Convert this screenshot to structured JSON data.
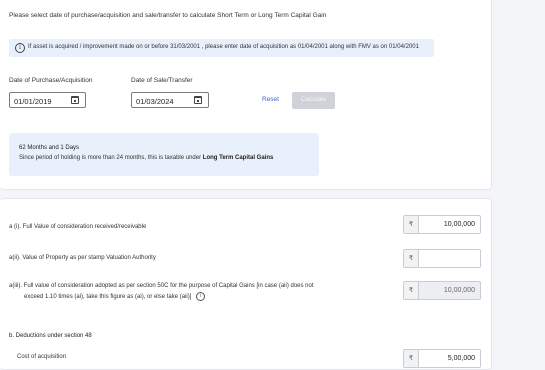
{
  "intro_text": "Please select date of purchase/acquisition and sale/transfer to calculate Short Term or Long Term Capital Gain",
  "info_banner": {
    "icon": "info-icon",
    "text": "If asset is acquired / improvement made on or before 31/03/2001 , please enter date of acquisition as 01/04/2001 along with FMV as on 01/04/2001"
  },
  "purchase": {
    "label": "Date of Purchase/Acquisition",
    "value": "01/01/2019"
  },
  "sale": {
    "label": "Date of Sale/Transfer",
    "value": "01/03/2024"
  },
  "actions": {
    "reset_label": "Reset",
    "calculate_label": "Calculate"
  },
  "result": {
    "duration": "62 Months and 1 Days",
    "text_prefix": "Since period of holding is more than 24 months, this is taxable under",
    "gain_type": "Long Term Capital Gains"
  },
  "rows": [
    {
      "label": "a (i). Full Value of consideration received/receivable",
      "currency": "₹",
      "value": "10,00,000",
      "disabled": false
    },
    {
      "label": "a(ii). Value of Property as per stamp Valuation Authority",
      "currency": "₹",
      "value": "",
      "disabled": false
    },
    {
      "label_line1": "a(iii). Full value of consideration adopted as per section 50C for the purpose of Capital Gains [in case (aii) does not",
      "label_line2": "exceed 1.10 times (ai), take this figure as (ai), or else take (aii)]",
      "currency": "₹",
      "value": "10,00,000",
      "disabled": true
    }
  ],
  "deductions": {
    "heading": "b. Deductions under section 48",
    "cost_label": "Cost of acquisition",
    "currency": "₹",
    "cost_value": "5,00,000"
  }
}
